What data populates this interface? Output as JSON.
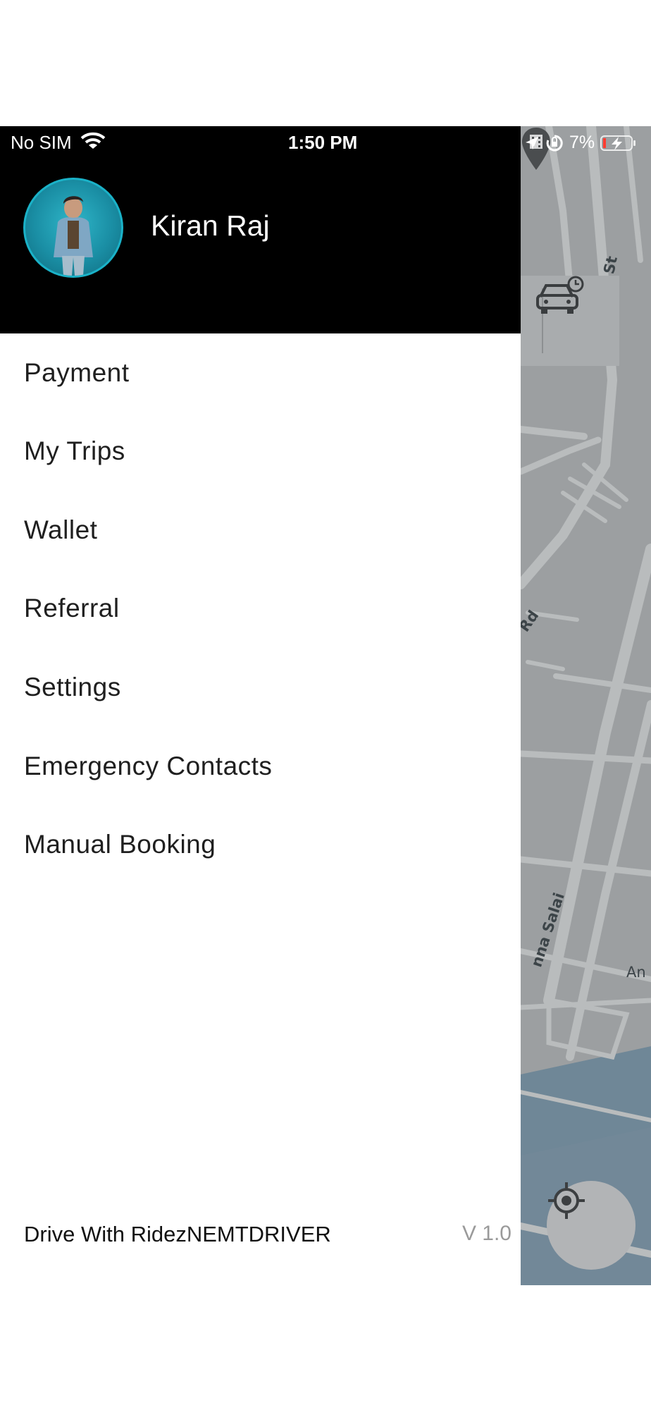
{
  "status_bar": {
    "carrier": "No SIM",
    "time": "1:50 PM",
    "battery_percent": "7%",
    "icons": [
      "wifi-icon",
      "location-arrow-icon",
      "orientation-lock-icon",
      "battery-charging-icon"
    ]
  },
  "drawer": {
    "user_name": "Kiran Raj",
    "menu_items": [
      {
        "label": "Payment"
      },
      {
        "label": "My Trips"
      },
      {
        "label": "Wallet"
      },
      {
        "label": "Referral"
      },
      {
        "label": "Settings"
      },
      {
        "label": "Emergency Contacts"
      },
      {
        "label": "Manual Booking"
      }
    ],
    "footer_link": "Drive With RidezNEMTDRIVER",
    "version": "V 1.0"
  },
  "map": {
    "street_labels": [
      "St",
      "Rd",
      "nna Salai",
      "An"
    ],
    "icons": [
      "scheduled-car-icon",
      "cinema-pin-icon",
      "my-location-icon"
    ],
    "colors": {
      "land": "#9c9fa1",
      "roads": "#b9bcbd",
      "water": "#6f8797"
    }
  },
  "colors": {
    "header_bg": "#000000",
    "avatar_ring": "#1ab2c8",
    "menu_text": "#1f1f1f",
    "version_text": "#9a9a9a"
  }
}
